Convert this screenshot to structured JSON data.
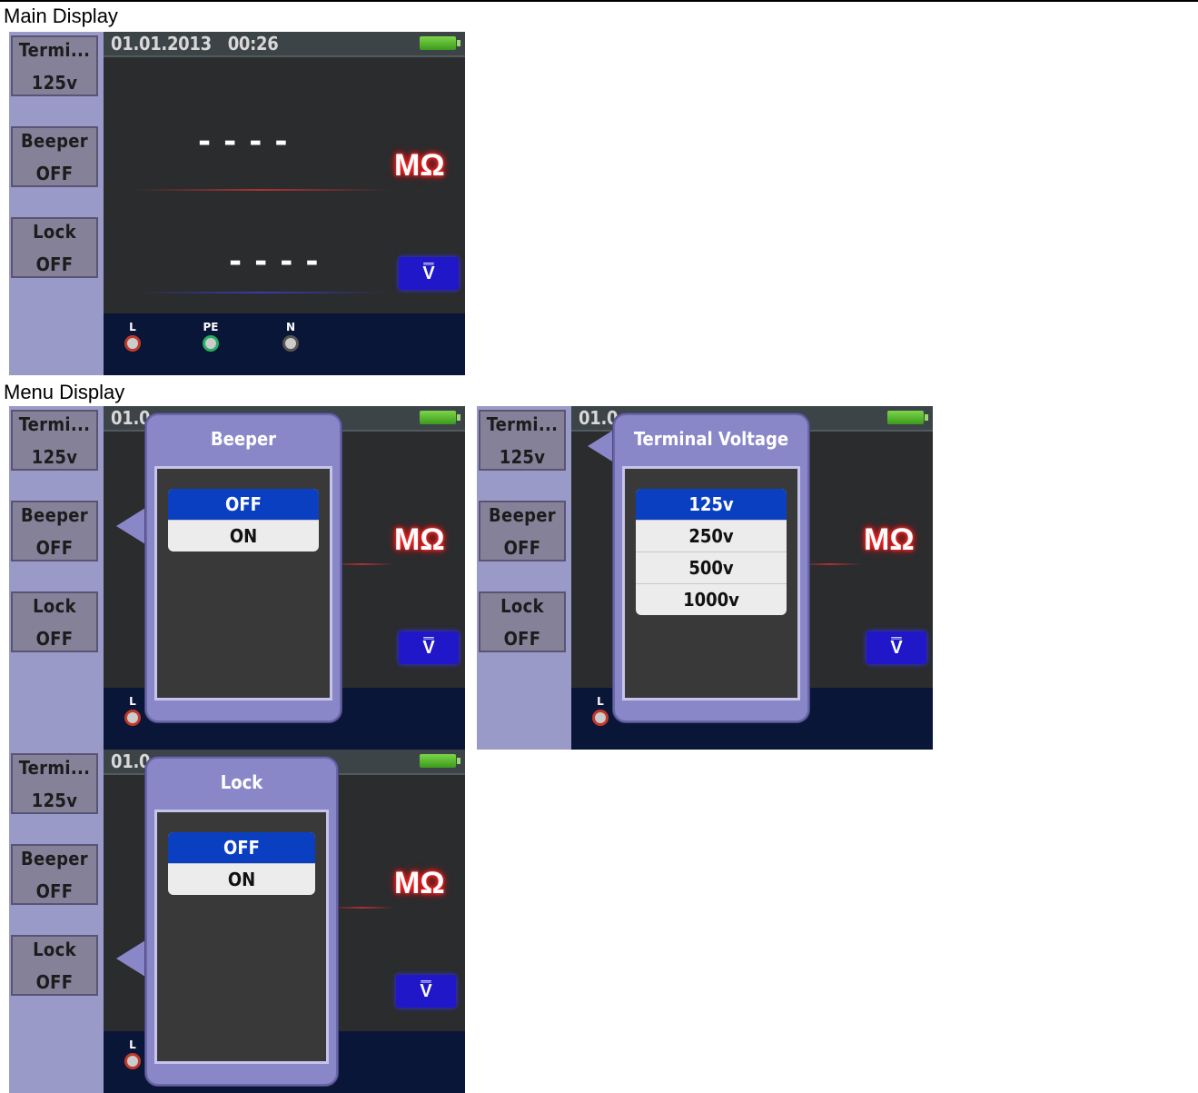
{
  "sections": {
    "main_label": "Main Display",
    "menu_label": "Menu Display"
  },
  "softkeys": {
    "terminal": {
      "title": "Termi...",
      "value": "125v"
    },
    "beeper": {
      "title": "Beeper",
      "value": "OFF"
    },
    "lock": {
      "title": "Lock",
      "value": "OFF"
    }
  },
  "status": {
    "datetime": "01.01.2013   00:26",
    "datetime_partial": "01.0"
  },
  "display": {
    "upper_reading": "----",
    "lower_reading": "----",
    "unit_primary": "MΩ",
    "unit_secondary": "V̿"
  },
  "terminals": [
    {
      "label": "L",
      "color": "#c0392b"
    },
    {
      "label": "PE",
      "color": "#27ae60"
    },
    {
      "label": "N",
      "color": "#7f7f7f"
    }
  ],
  "popups": {
    "beeper": {
      "title": "Beeper",
      "options": [
        "OFF",
        "ON"
      ],
      "selected": "OFF"
    },
    "terminal_voltage": {
      "title": "Terminal Voltage",
      "options": [
        "125v",
        "250v",
        "500v",
        "1000v"
      ],
      "selected": "125v"
    },
    "lock": {
      "title": "Lock",
      "options": [
        "OFF",
        "ON"
      ],
      "selected": "OFF"
    }
  },
  "colors": {
    "sidebar": "#9a9ac8",
    "popup": "#8a87c9",
    "selected_option": "#0b3fc2",
    "unit_glow": "#ff2a2a"
  }
}
